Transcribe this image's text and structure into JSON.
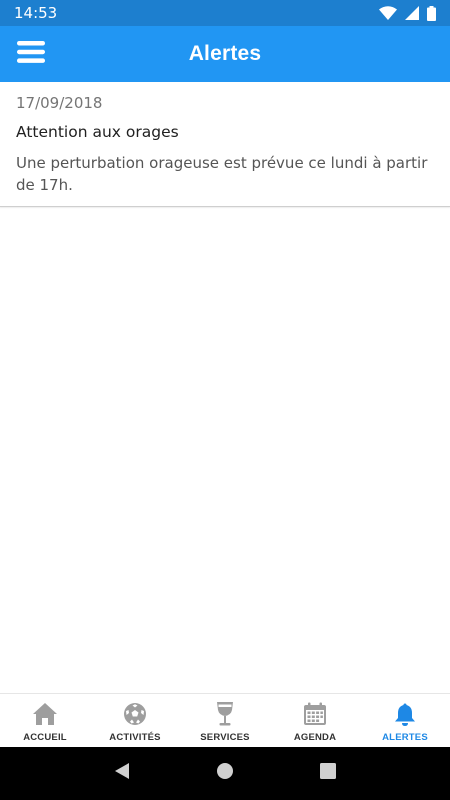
{
  "status_bar": {
    "time": "14:53",
    "icons": [
      "wifi-icon",
      "signal-icon",
      "battery-icon"
    ]
  },
  "app_bar": {
    "title": "Alertes",
    "menu_icon": "hamburger-menu-icon",
    "color": "#2196f3"
  },
  "alerts": [
    {
      "date": "17/09/2018",
      "title": "Attention aux orages",
      "body": "Une perturbation orageuse est prévue ce lundi à partir de 17h."
    }
  ],
  "bottom_nav": {
    "items": [
      {
        "label": "ACCUEIL",
        "icon": "home-icon",
        "active": false
      },
      {
        "label": "ACTIVITÉS",
        "icon": "soccer-ball-icon",
        "active": false
      },
      {
        "label": "SERVICES",
        "icon": "wine-glass-icon",
        "active": false
      },
      {
        "label": "AGENDA",
        "icon": "calendar-icon",
        "active": false
      },
      {
        "label": "ALERTES",
        "icon": "bell-icon",
        "active": true
      }
    ],
    "active_color": "#1e88e5",
    "inactive_icon_color": "#9e9e9e"
  },
  "system_nav": {
    "buttons": [
      "back-icon",
      "home-circle-icon",
      "recents-square-icon"
    ]
  }
}
